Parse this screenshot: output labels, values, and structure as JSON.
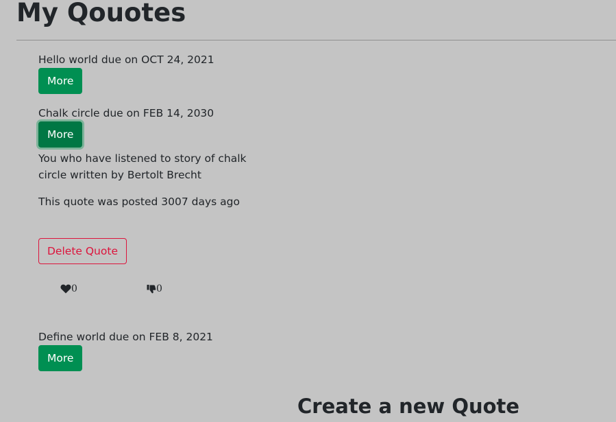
{
  "header": {
    "title": "My Qouotes"
  },
  "quotes": [
    {
      "heading": "Hello world due on OCT 24, 2021",
      "more_label": "More"
    },
    {
      "heading": "Chalk circle due on FEB 14, 2030",
      "more_label": "More",
      "expanded": true,
      "text": "You who have listened to story of chalk circle written by Bertolt Brecht",
      "posted": "This quote was posted 3007 days ago",
      "delete_label": "Delete Quote",
      "likes": "0",
      "dislikes": "0",
      "like_icon": "heart-icon",
      "dislike_icon": "thumbs-down-icon"
    },
    {
      "heading": "Define world due on FEB 8, 2021",
      "more_label": "More"
    }
  ],
  "form": {
    "title": "Create a new Quote"
  },
  "colors": {
    "background": "#c4c4c4",
    "more_button": "#008f52",
    "more_button_active": "#007744",
    "delete_button": "#dc143c",
    "text": "#212529"
  }
}
